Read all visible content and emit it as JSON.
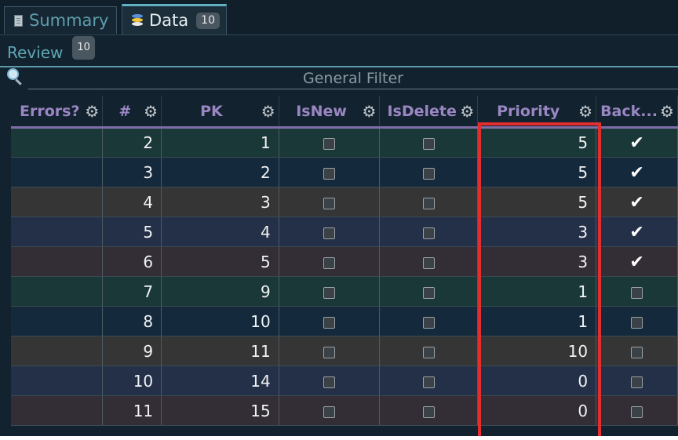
{
  "tabs": [
    {
      "label": "Summary",
      "icon": "document-icon",
      "active": false
    },
    {
      "label": "Data",
      "icon": "database-icon",
      "active": true,
      "badge": "10"
    }
  ],
  "review": {
    "label": "Review",
    "badge": "10"
  },
  "filter": {
    "placeholder": "General Filter",
    "icon": "search-icon"
  },
  "columns": [
    "Errors?",
    "#",
    "PK",
    "IsNew",
    "IsDelete",
    "Priority",
    "Back..."
  ],
  "rows": [
    {
      "errors": "",
      "num": "2",
      "pk": "1",
      "isnew": false,
      "isdelete": false,
      "priority": "5",
      "back": true
    },
    {
      "errors": "",
      "num": "3",
      "pk": "2",
      "isnew": false,
      "isdelete": false,
      "priority": "5",
      "back": true
    },
    {
      "errors": "",
      "num": "4",
      "pk": "3",
      "isnew": false,
      "isdelete": false,
      "priority": "5",
      "back": true
    },
    {
      "errors": "",
      "num": "5",
      "pk": "4",
      "isnew": false,
      "isdelete": false,
      "priority": "3",
      "back": true
    },
    {
      "errors": "",
      "num": "6",
      "pk": "5",
      "isnew": false,
      "isdelete": false,
      "priority": "3",
      "back": true
    },
    {
      "errors": "",
      "num": "7",
      "pk": "9",
      "isnew": false,
      "isdelete": false,
      "priority": "1",
      "back": false
    },
    {
      "errors": "",
      "num": "8",
      "pk": "10",
      "isnew": false,
      "isdelete": false,
      "priority": "1",
      "back": false
    },
    {
      "errors": "",
      "num": "9",
      "pk": "11",
      "isnew": false,
      "isdelete": false,
      "priority": "10",
      "back": false
    },
    {
      "errors": "",
      "num": "10",
      "pk": "14",
      "isnew": false,
      "isdelete": false,
      "priority": "0",
      "back": false
    },
    {
      "errors": "",
      "num": "11",
      "pk": "15",
      "isnew": false,
      "isdelete": false,
      "priority": "0",
      "back": false
    }
  ],
  "colors": {
    "header_text": "#9a86c3",
    "accent": "#5fb1c4",
    "highlight_box": "#e22e2e"
  }
}
